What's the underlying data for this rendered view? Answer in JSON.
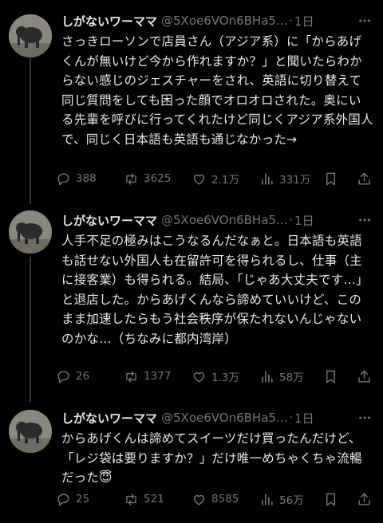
{
  "tweets": [
    {
      "name": "しがないワーママ",
      "handle": "@5Xoe6VOn6BHa5...",
      "time": "1日",
      "text": "さっきローソンで店員さん（アジア系）に「からあげくんが無いけど今から作れますか？」と聞いたらわからない感じのジェスチャーをされ、英語に切り替えて同じ質問をしても困った顔でオロオロされた。奥にいる先輩を呼びに行ってくれたけど同じくアジア系外国人で、同じく日本語も英語も通じなかった→",
      "replies": "388",
      "reposts": "3625",
      "likes": "2.1万",
      "views": "331万"
    },
    {
      "name": "しがないワーママ",
      "handle": "@5Xoe6VOn6BHa5...",
      "time": "1日",
      "text": "人手不足の極みはこうなるんだなぁと。日本語も英語も話せない外国人も在留許可を得られるし、仕事（主に接客業）も得られる。結局、「じゃあ大丈夫です…」と退店した。からあげくんなら諦めていいけど、このまま加速したらもう社会秩序が保たれないんじゃないのかな…（ちなみに都内湾岸）",
      "replies": "26",
      "reposts": "1377",
      "likes": "1.3万",
      "views": "58万"
    },
    {
      "name": "しがないワーママ",
      "handle": "@5Xoe6VOn6BHa5...",
      "time": "1日",
      "text": "からあげくんは諦めてスイーツだけ買ったんだけど、「レジ袋は要りますか？」だけ唯一めちゃくちゃ流暢だった😇",
      "replies": "25",
      "reposts": "521",
      "likes": "8585",
      "views": "56万"
    }
  ],
  "colors": {
    "background": "#000000",
    "text": "#e7e9ea",
    "muted": "#71767b",
    "thread_line": "#333639"
  },
  "icons": {
    "more": "more-dots-icon",
    "reply": "reply-icon",
    "repost": "repost-icon",
    "like": "heart-icon",
    "views": "views-chart-icon",
    "bookmark": "bookmark-icon",
    "share": "share-icon"
  }
}
